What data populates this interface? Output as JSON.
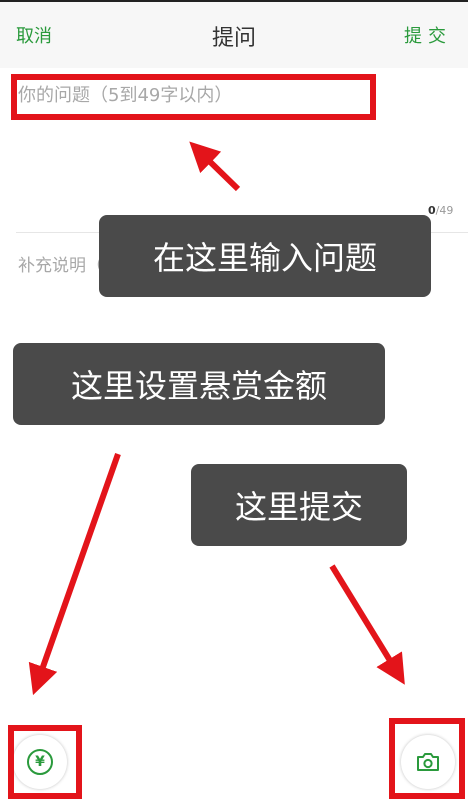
{
  "navbar": {
    "cancel_label": "取消",
    "title": "提问",
    "submit_label": "提交"
  },
  "question": {
    "placeholder": "你的问题（5到49字以内）",
    "char_count": "0",
    "char_limit": "/49"
  },
  "details": {
    "placeholder": "补充说明（选填）"
  },
  "annotations": {
    "question_tip": "在这里输入问题",
    "reward_tip": "这里设置悬赏金额",
    "submit_tip": "这里提交"
  },
  "toolbar": {
    "reward_symbol": "¥",
    "reward_icon": "yen-icon",
    "photo_icon": "camera-icon"
  },
  "colors": {
    "accent": "#2a9a3c",
    "highlight": "#e3141a",
    "tooltip_bg": "#4a4a4a"
  }
}
